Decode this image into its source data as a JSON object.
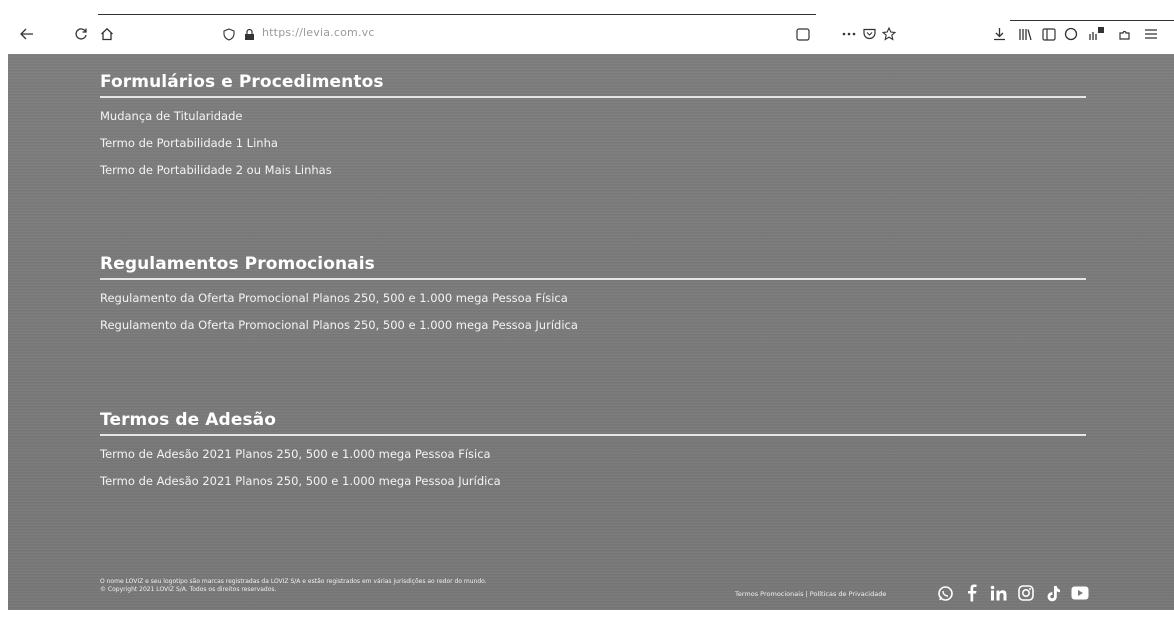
{
  "browser": {
    "url_text": "https://levia.com.vc",
    "icons": [
      "back-arrow-icon",
      "reload-icon",
      "home-icon",
      "shield-icon",
      "lock-icon",
      "reader-view-icon",
      "more-icon",
      "pocket-icon",
      "star-icon",
      "download-icon",
      "library-icon",
      "sidebar-icon",
      "account-icon",
      "extensions-icon",
      "extension-icon",
      "menu-icon"
    ]
  },
  "sections": [
    {
      "title": "Formulários e Procedimentos",
      "links": [
        "Mudança de Titularidade",
        "Termo de Portabilidade 1 Linha",
        "Termo de Portabilidade 2 ou Mais Linhas"
      ]
    },
    {
      "title": "Regulamentos Promocionais",
      "links": [
        "Regulamento da Oferta Promocional Planos 250, 500 e 1.000 mega Pessoa Física",
        "Regulamento da Oferta Promocional Planos 250, 500 e 1.000 mega Pessoa Jurídica"
      ]
    },
    {
      "title": "Termos de Adesão",
      "links": [
        "Termo de Adesão 2021 Planos 250, 500 e 1.000 mega Pessoa Física",
        "Termo de Adesão 2021 Planos 250, 500 e 1.000 mega Pessoa Jurídica"
      ]
    }
  ],
  "footer": {
    "legal_line_1": "O nome LOVIZ e seu logotipo são marcas registradas da LOVIZ S/A e estão registrados em várias jurisdições ao redor do mundo.",
    "legal_line_2": "© Copyright 2021 LOVIZ S/A. Todos os direitos reservados.",
    "links_text": "Termos Promocionais | Políticas de Privacidade",
    "social_icons": [
      "whatsapp-icon",
      "facebook-icon",
      "linkedin-icon",
      "instagram-icon",
      "tiktok-icon",
      "youtube-icon"
    ]
  },
  "colors": {
    "page_bg": "#7a7a7a",
    "text": "#ffffff",
    "divider": "#e6e6e6"
  }
}
